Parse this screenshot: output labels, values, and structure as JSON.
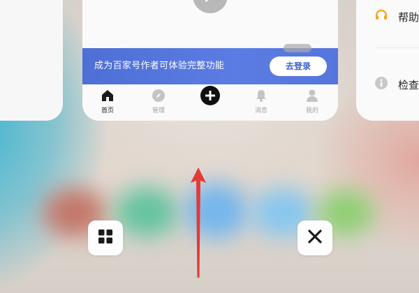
{
  "main_card": {
    "banner": {
      "text": "成为百家号作者可体验完整功能",
      "login_label": "去登录"
    },
    "tabs": [
      {
        "label": "首页",
        "icon": "home-icon",
        "active": true
      },
      {
        "label": "管理",
        "icon": "compass-icon",
        "active": false
      },
      {
        "label": "",
        "icon": "add-icon",
        "active": false
      },
      {
        "label": "消息",
        "icon": "bell-icon",
        "active": false
      },
      {
        "label": "我的",
        "icon": "person-icon",
        "active": false
      }
    ]
  },
  "right_card": {
    "items": [
      {
        "label": "帮助",
        "icon": "headset-icon"
      },
      {
        "label": "检查",
        "icon": "info-icon"
      }
    ]
  },
  "controls": {
    "menu_icon": "grid-icon",
    "close_icon": "close-icon"
  },
  "colors": {
    "banner": "#5575dc",
    "login_text": "#3b5fd0",
    "arrow": "#e53935",
    "headset": "#f5a623"
  }
}
